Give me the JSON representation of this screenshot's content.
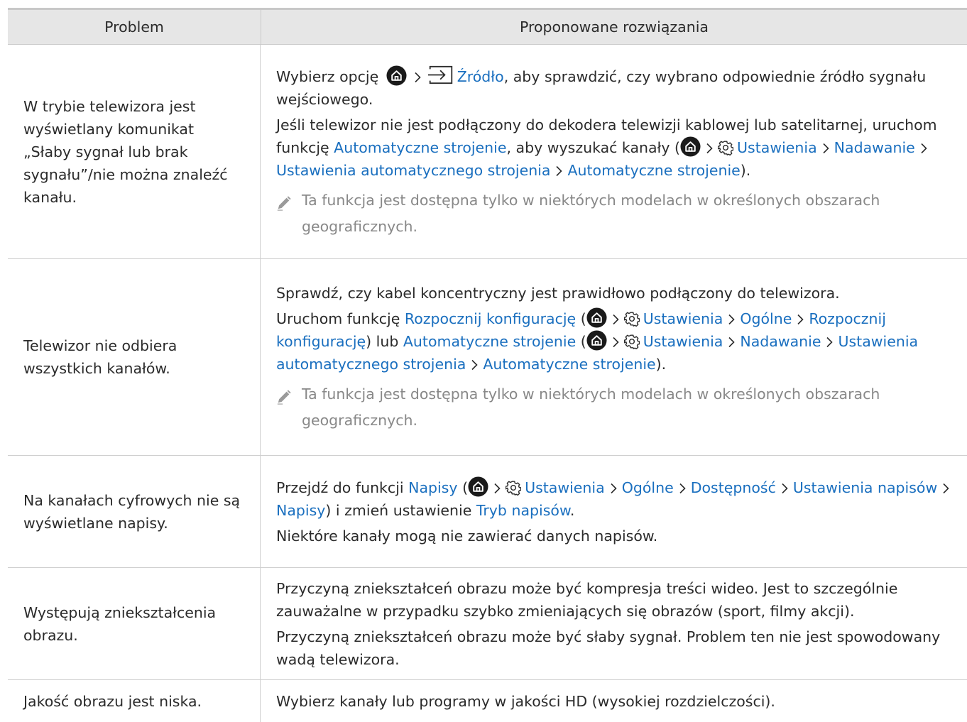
{
  "header": {
    "problem": "Problem",
    "solutions": "Proponowane rozwiązania"
  },
  "icons": {
    "home": "home-icon",
    "source": "source-input-icon",
    "settings": "gear-icon",
    "chevron": "chevron-right-icon",
    "note": "pencil-note-icon"
  },
  "colors": {
    "link": "#1a6fbf",
    "note": "#888888",
    "header_bg": "#e6e6e6"
  },
  "rows": [
    {
      "problem": "W trybie telewizora jest wyświetlany komunikat „Słaby sygnał lub brak sygnału”/nie można znaleźć kanału.",
      "p1_a": "Wybierz opcję",
      "p1_b": "Źródło",
      "p1_c": ", aby sprawdzić, czy wybrano odpowiednie źródło sygnału wejściowego.",
      "p2_a": "Jeśli telewizor nie jest podłączony do dekodera telewizji kablowej lub satelitarnej, uruchom funkcję ",
      "p2_b": "Automatyczne strojenie",
      "p2_c": ", aby wyszukać kanały (",
      "p2_d": "Ustawienia",
      "p2_e": "Nadawanie",
      "p2_f": "Ustawienia automatycznego strojenia",
      "p2_g": "Automatyczne strojenie",
      "p2_h": ").",
      "note": "Ta funkcja jest dostępna tylko w niektórych modelach w określonych obszarach geograficznych."
    },
    {
      "problem": "Telewizor nie odbiera wszystkich kanałów.",
      "p1": "Sprawdź, czy kabel koncentryczny jest prawidłowo podłączony do telewizora.",
      "p2_a": "Uruchom funkcję ",
      "p2_b": "Rozpocznij konfigurację",
      "p2_c": " (",
      "p2_d": "Ustawienia",
      "p2_e": "Ogólne",
      "p2_f": "Rozpocznij konfigurację",
      "p2_g": ") lub ",
      "p2_h": "Automatyczne strojenie",
      "p2_i": " (",
      "p2_j": "Ustawienia",
      "p2_k": "Nadawanie",
      "p2_l": "Ustawienia automatycznego strojenia",
      "p2_m": "Automatyczne strojenie",
      "p2_n": ").",
      "note": "Ta funkcja jest dostępna tylko w niektórych modelach w określonych obszarach geograficznych."
    },
    {
      "problem": "Na kanałach cyfrowych nie są wyświetlane napisy.",
      "p1_a": "Przejdź do funkcji ",
      "p1_b": "Napisy",
      "p1_c": " (",
      "p1_d": "Ustawienia",
      "p1_e": "Ogólne",
      "p1_f": "Dostępność",
      "p1_g": "Ustawienia napisów",
      "p1_h": "Napisy",
      "p1_i": ") i zmień ustawienie ",
      "p1_j": "Tryb napisów",
      "p1_k": ".",
      "p2": "Niektóre kanały mogą nie zawierać danych napisów."
    },
    {
      "problem": "Występują zniekształcenia obrazu.",
      "p1": "Przyczyną zniekształceń obrazu może być kompresja treści wideo. Jest to szczególnie zauważalne w przypadku szybko zmieniających się obrazów (sport, filmy akcji).",
      "p2": "Przyczyną zniekształceń obrazu może być słaby sygnał. Problem ten nie jest spowodowany wadą telewizora."
    },
    {
      "problem": "Jakość obrazu jest niska.",
      "p1": "Wybierz kanały lub programy w jakości HD (wysokiej rozdzielczości)."
    }
  ]
}
